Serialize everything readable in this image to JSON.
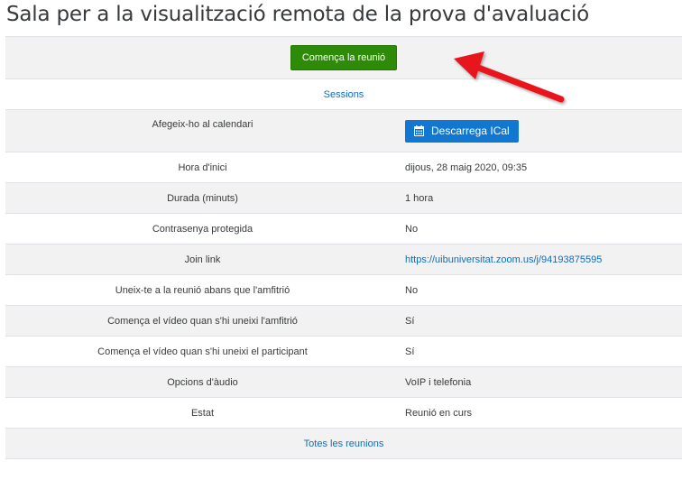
{
  "page": {
    "title": "Sala per a la visualització remota de la prova d'avaluació"
  },
  "actions": {
    "start_meeting": "Comença la reunió",
    "sessions": "Sessions",
    "all_meetings": "Totes les reunions"
  },
  "details": {
    "calendar_label": "Afegeix-ho al calendari",
    "ical_button": "Descarrega ICal",
    "rows": [
      {
        "label": "Hora d'inici",
        "value": "dijous, 28 maig 2020, 09:35"
      },
      {
        "label": "Durada (minuts)",
        "value": "1 hora"
      },
      {
        "label": "Contrasenya protegida",
        "value": "No"
      },
      {
        "label": "Join link",
        "value": "https://uibuniversitat.zoom.us/j/94193875595"
      },
      {
        "label": "Uneix-te a la reunió abans que l'amfitrió",
        "value": "No"
      },
      {
        "label": "Comença el vídeo quan s'hi uneixi l'amfitrió",
        "value": "Sí"
      },
      {
        "label": "Comença el vídeo quan s'hi uneixi el participant",
        "value": "Sí"
      },
      {
        "label": "Opcions d'àudio",
        "value": "VoIP i telefonia"
      },
      {
        "label": "Estat",
        "value": "Reunió en curs"
      }
    ]
  },
  "icons": {
    "calendar": "calendar-icon",
    "annotation": "red-arrow-icon"
  },
  "colors": {
    "start_button": "#2e8b08",
    "ical_button": "#1177d1",
    "link": "#0f6cbf",
    "row_alt": "#f2f2f2",
    "arrow": "#e8141a"
  }
}
